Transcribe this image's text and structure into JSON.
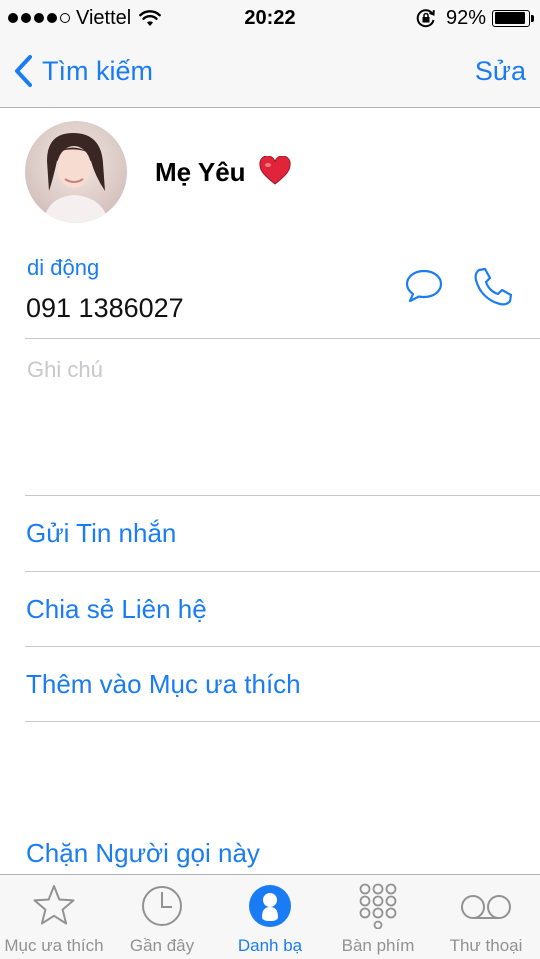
{
  "status_bar": {
    "carrier": "Viettel",
    "time": "20:22",
    "battery_percent": "92%",
    "battery_level": 0.92,
    "signal_bars": 4,
    "signal_total": 5
  },
  "nav": {
    "back_label": "Tìm kiếm",
    "edit_label": "Sửa"
  },
  "contact": {
    "name": "Mẹ Yêu",
    "name_emoji": "red-heart",
    "phone_label": "di động",
    "phone_number": "091 1386027",
    "notes_placeholder": "Ghi chú"
  },
  "actions": {
    "send_message": "Gửi Tin nhắn",
    "share_contact": "Chia sẻ Liên hệ",
    "add_favorite": "Thêm vào Mục ưa thích",
    "block_caller": "Chặn Người gọi này"
  },
  "tabs": [
    {
      "label": "Mục ưa thích",
      "icon": "star-icon"
    },
    {
      "label": "Gần đây",
      "icon": "clock-icon"
    },
    {
      "label": "Danh bạ",
      "icon": "person-icon"
    },
    {
      "label": "Bàn phím",
      "icon": "keypad-icon"
    },
    {
      "label": "Thư thoại",
      "icon": "voicemail-icon"
    }
  ],
  "active_tab": "Danh bạ",
  "colors": {
    "accent": "#1a7cf5",
    "inactive": "#929292",
    "placeholder": "#c7c7cd",
    "bar_background": "#f7f7f7"
  }
}
